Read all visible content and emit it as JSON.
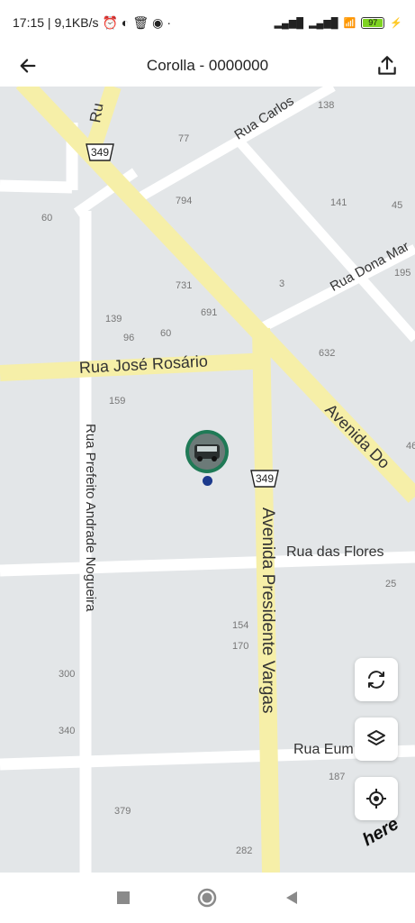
{
  "status_bar": {
    "time_and_speed": "17:15 | 9,1KB/s",
    "battery_level": "97"
  },
  "app_bar": {
    "title": "Corolla - 0000000",
    "back_icon": "arrow-left-icon",
    "share_icon": "upload-icon"
  },
  "map": {
    "roads": {
      "r1": "Ru",
      "r2": "Rua Carlos",
      "r3": "Rua Dona Mar",
      "r4": "Rua José Rosário",
      "r5": "Avenida Do",
      "r6": "Rua Prefeito Andrade Nogueira",
      "r7": "Avenida Presidente Vargas",
      "r8": "Rua das Flores",
      "r9": "Rua Eum"
    },
    "highway_shield": "349",
    "numbers": {
      "n138": "138",
      "n77": "77",
      "n794": "794",
      "n141": "141",
      "n45": "45",
      "n60a": "60",
      "n195": "195",
      "n731": "731",
      "n3": "3",
      "n691": "691",
      "n139": "139",
      "n96": "96",
      "n60b": "60",
      "n632": "632",
      "n159": "159",
      "n46": "46",
      "n25": "25",
      "n154": "154",
      "n170": "170",
      "n300": "300",
      "n340": "340",
      "n187": "187",
      "n379": "379",
      "n282": "282"
    },
    "attribution": "here"
  },
  "controls": {
    "refresh_icon": "refresh-icon",
    "layers_icon": "layers-icon",
    "locate_icon": "my-location-icon"
  },
  "nav_bar": {
    "recents_icon": "square-icon",
    "home_icon": "circle-icon",
    "back_icon": "triangle-back-icon"
  }
}
